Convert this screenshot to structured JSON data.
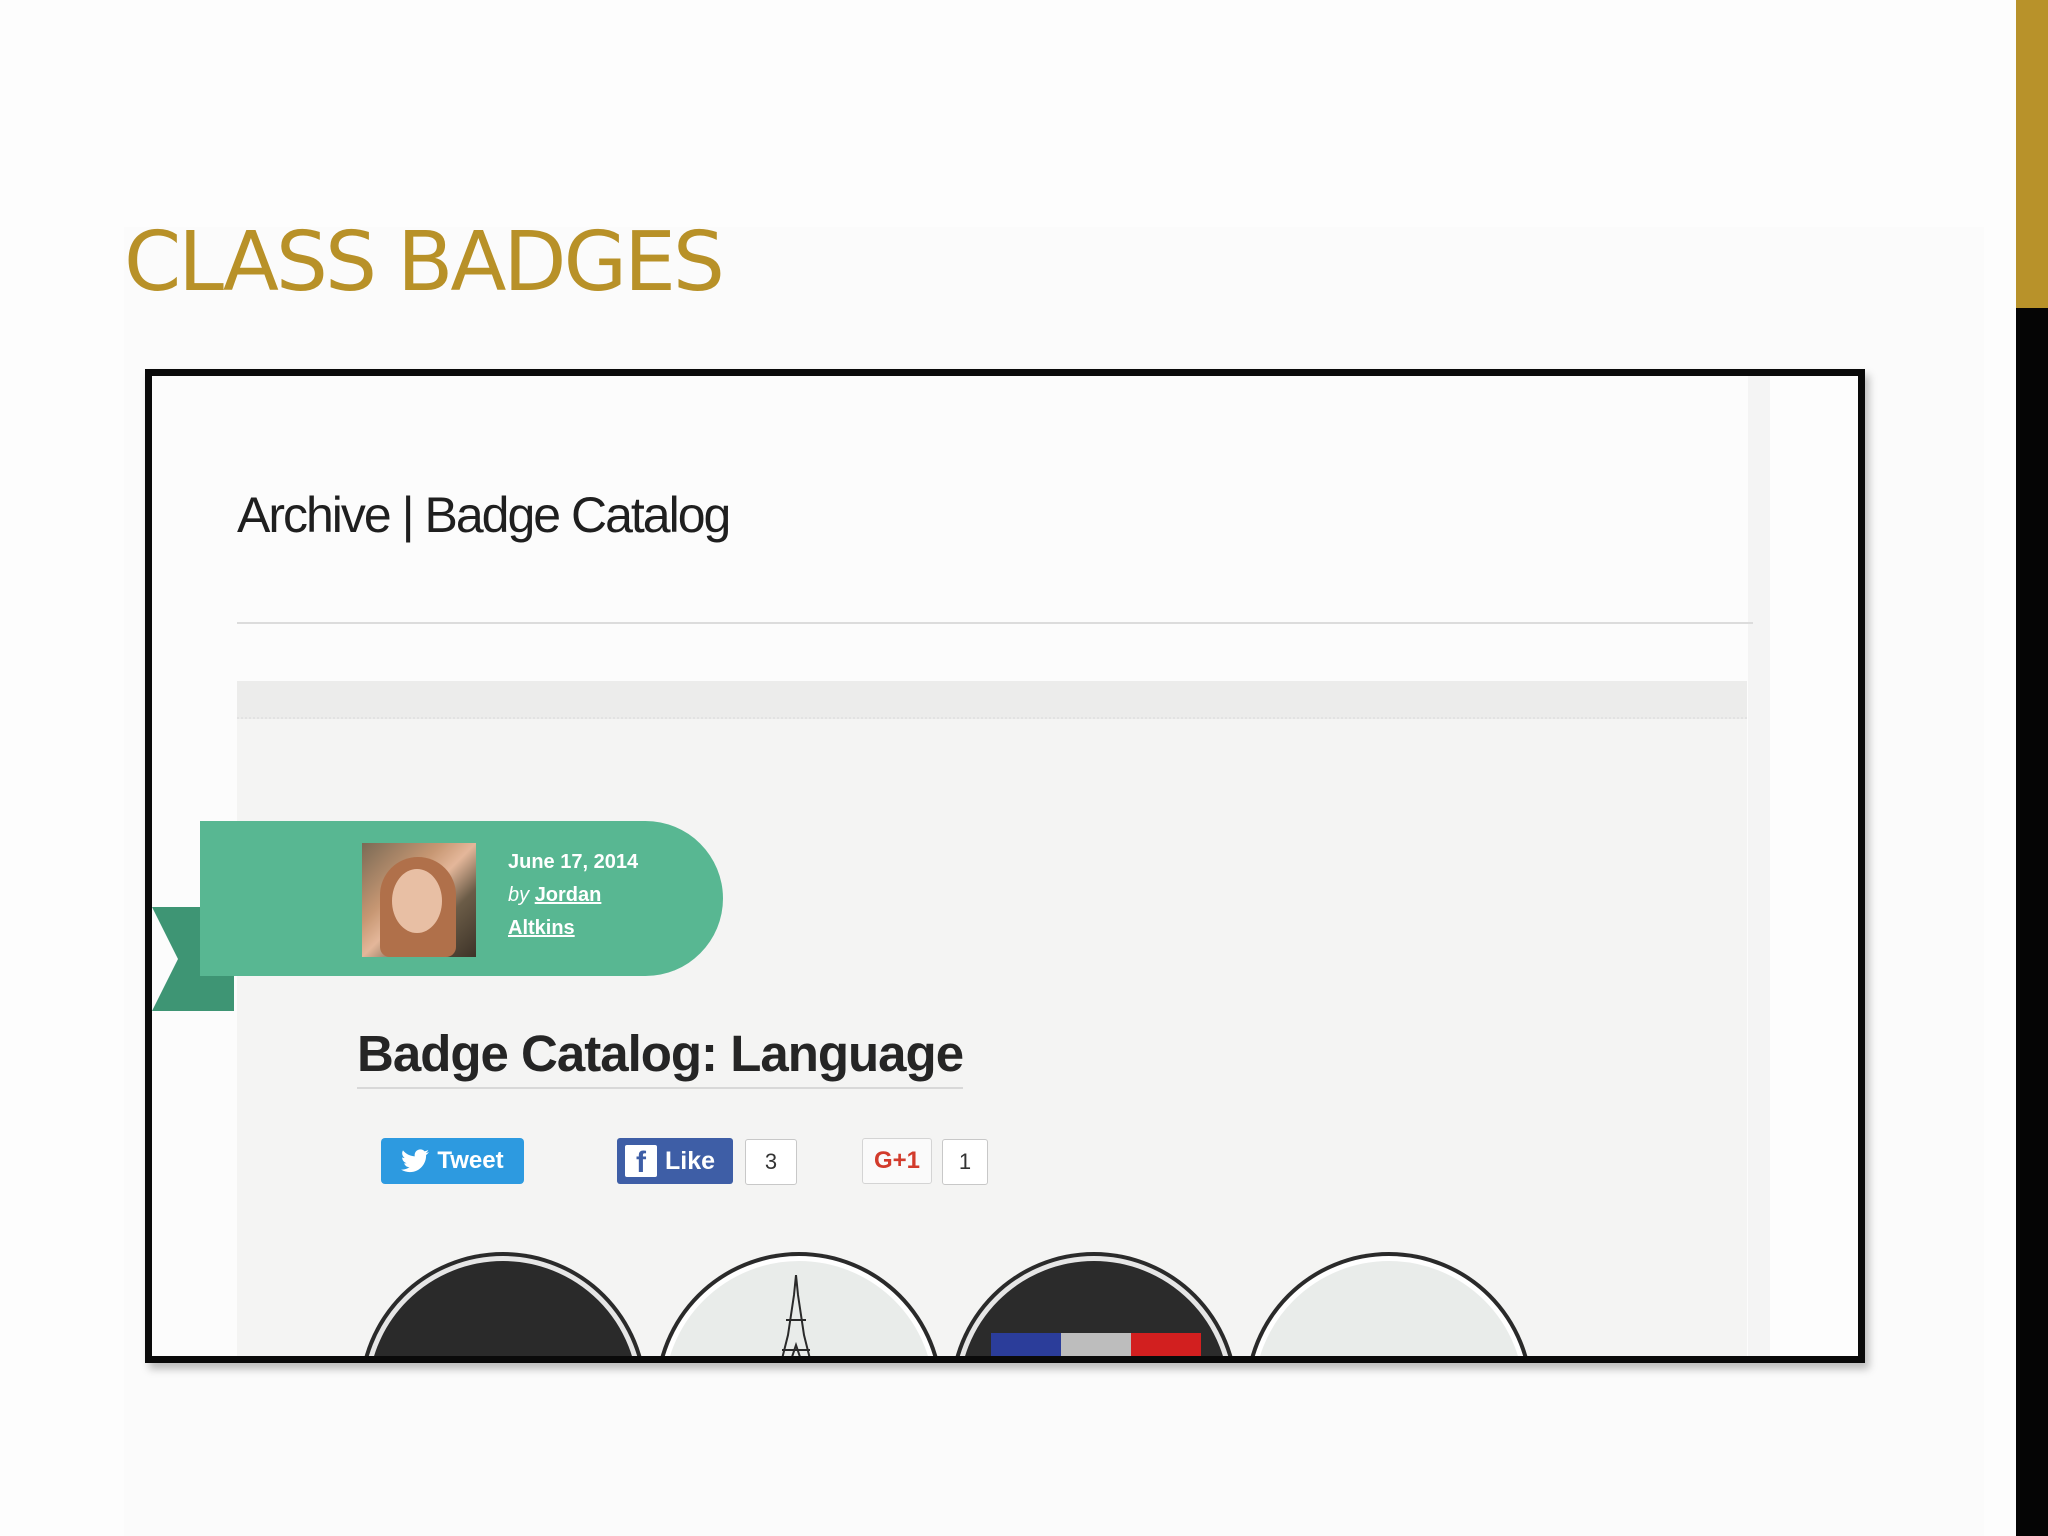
{
  "slide": {
    "title": "CLASS BADGES",
    "accent_color": "#b8922a"
  },
  "screenshot": {
    "page_heading": "Archive | Badge Catalog",
    "post": {
      "date": "June 17, 2014",
      "by_label": "by",
      "author_first": "Jordan",
      "author_last": "Altkins",
      "title": "Badge Catalog: Language",
      "ribbon_color": "#58b792"
    },
    "share": {
      "tweet_label": "Tweet",
      "like_label": "Like",
      "like_count": "3",
      "gplus_label": "G+1",
      "gplus_count": "1"
    },
    "badges": [
      {
        "name": "badge-dark"
      },
      {
        "name": "badge-eiffel"
      },
      {
        "name": "badge-flag"
      },
      {
        "name": "badge-light"
      }
    ]
  }
}
